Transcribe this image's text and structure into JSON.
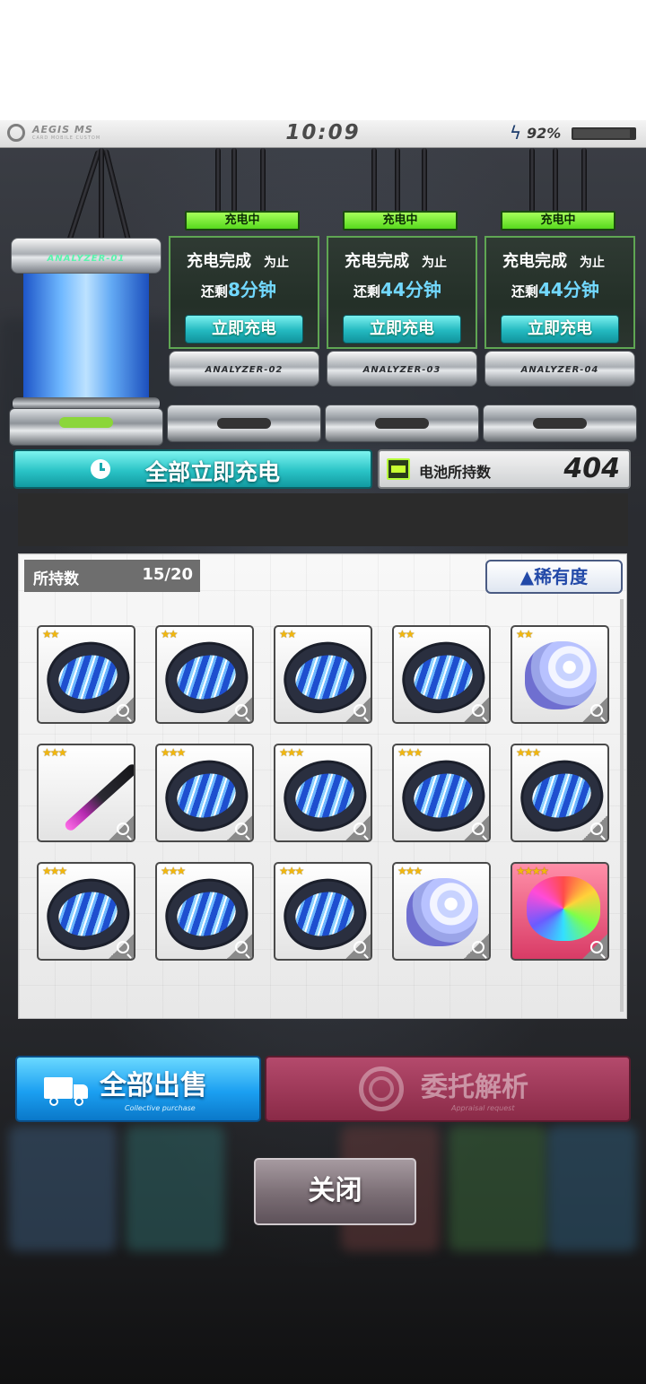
{
  "status_bar": {
    "brand": "AEGIS MS",
    "brand_sub": "CARD MOBILE CUSTOM",
    "time": "10:09",
    "battery_percent_text": "92%",
    "battery_level": 0.92
  },
  "analyzers": {
    "main_label": "ANALYZER-01",
    "slots": [
      {
        "label": "ANALYZER-02",
        "status": "充电中",
        "line1": "充电完成",
        "line1_suffix": "为止",
        "line2_prefix": "还剩",
        "remaining": "8分钟",
        "button": "立即充电"
      },
      {
        "label": "ANALYZER-03",
        "status": "充电中",
        "line1": "充电完成",
        "line1_suffix": "为止",
        "line2_prefix": "还剩",
        "remaining": "44分钟",
        "button": "立即充电"
      },
      {
        "label": "ANALYZER-04",
        "status": "充电中",
        "line1": "充电完成",
        "line1_suffix": "为止",
        "line2_prefix": "还剩",
        "remaining": "44分钟",
        "button": "立即充电"
      }
    ]
  },
  "charge_all": {
    "label": "全部立即充电",
    "icon": "clock-icon"
  },
  "battery_stock": {
    "label": "电池所持数",
    "count": "404",
    "icon": "battery-icon"
  },
  "inventory": {
    "owned_label": "所持数",
    "owned_value": "15/20",
    "sort_label": "▲稀有度",
    "items": [
      {
        "kind": "clam",
        "stars": "★★"
      },
      {
        "kind": "clam",
        "stars": "★★"
      },
      {
        "kind": "clam",
        "stars": "★★"
      },
      {
        "kind": "clam",
        "stars": "★★"
      },
      {
        "kind": "shell",
        "stars": "★★"
      },
      {
        "kind": "needle",
        "stars": "★★★"
      },
      {
        "kind": "clam",
        "stars": "★★★"
      },
      {
        "kind": "clam",
        "stars": "★★★"
      },
      {
        "kind": "clam",
        "stars": "★★★"
      },
      {
        "kind": "clam",
        "stars": "★★★"
      },
      {
        "kind": "clam",
        "stars": "★★★"
      },
      {
        "kind": "clam",
        "stars": "★★★"
      },
      {
        "kind": "clam",
        "stars": "★★★"
      },
      {
        "kind": "shell",
        "stars": "★★★"
      },
      {
        "kind": "rainbow",
        "stars": "★★★★"
      }
    ]
  },
  "actions": {
    "sell_all": {
      "label": "全部出售",
      "sub": "Collective purchase",
      "icon": "truck-icon"
    },
    "appraise": {
      "label": "委托解析",
      "sub": "Appraisal request",
      "icon": "analyze-ring-icon"
    },
    "close": {
      "label": "关闭"
    }
  }
}
